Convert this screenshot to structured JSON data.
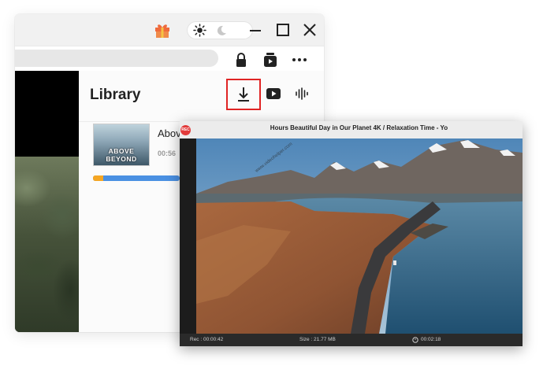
{
  "library": {
    "title": "Library",
    "items": [
      {
        "title": "Above",
        "time": "00:56",
        "thumbnail_text": [
          "ABOVE",
          "BEYOND"
        ],
        "progress_colors": [
          "#f5a623",
          "#4a90e2"
        ]
      }
    ]
  },
  "toolbar": {
    "icons": [
      "gift-icon",
      "sun-icon",
      "moon-icon",
      "minimize-icon",
      "maximize-icon",
      "close-icon"
    ],
    "address_icons": [
      "lock-icon",
      "capture-icon",
      "more-icon"
    ],
    "library_icons": [
      "download-icon",
      "youtube-icon",
      "audio-wave-icon"
    ]
  },
  "recording": {
    "rec_badge": "REC",
    "title": "Hours Beautiful Day in Our Planet 4K / Relaxation Time - Yo",
    "watermark": "www.videohelper.com",
    "rec_time": "Rec : 00:00:42",
    "size": "Size : 21.77 MB",
    "timer": "00:02:18"
  },
  "colors": {
    "highlight": "#e02424",
    "rec_red": "#e23b3b",
    "progress_orange": "#f5a623",
    "progress_blue": "#4a90e2"
  }
}
